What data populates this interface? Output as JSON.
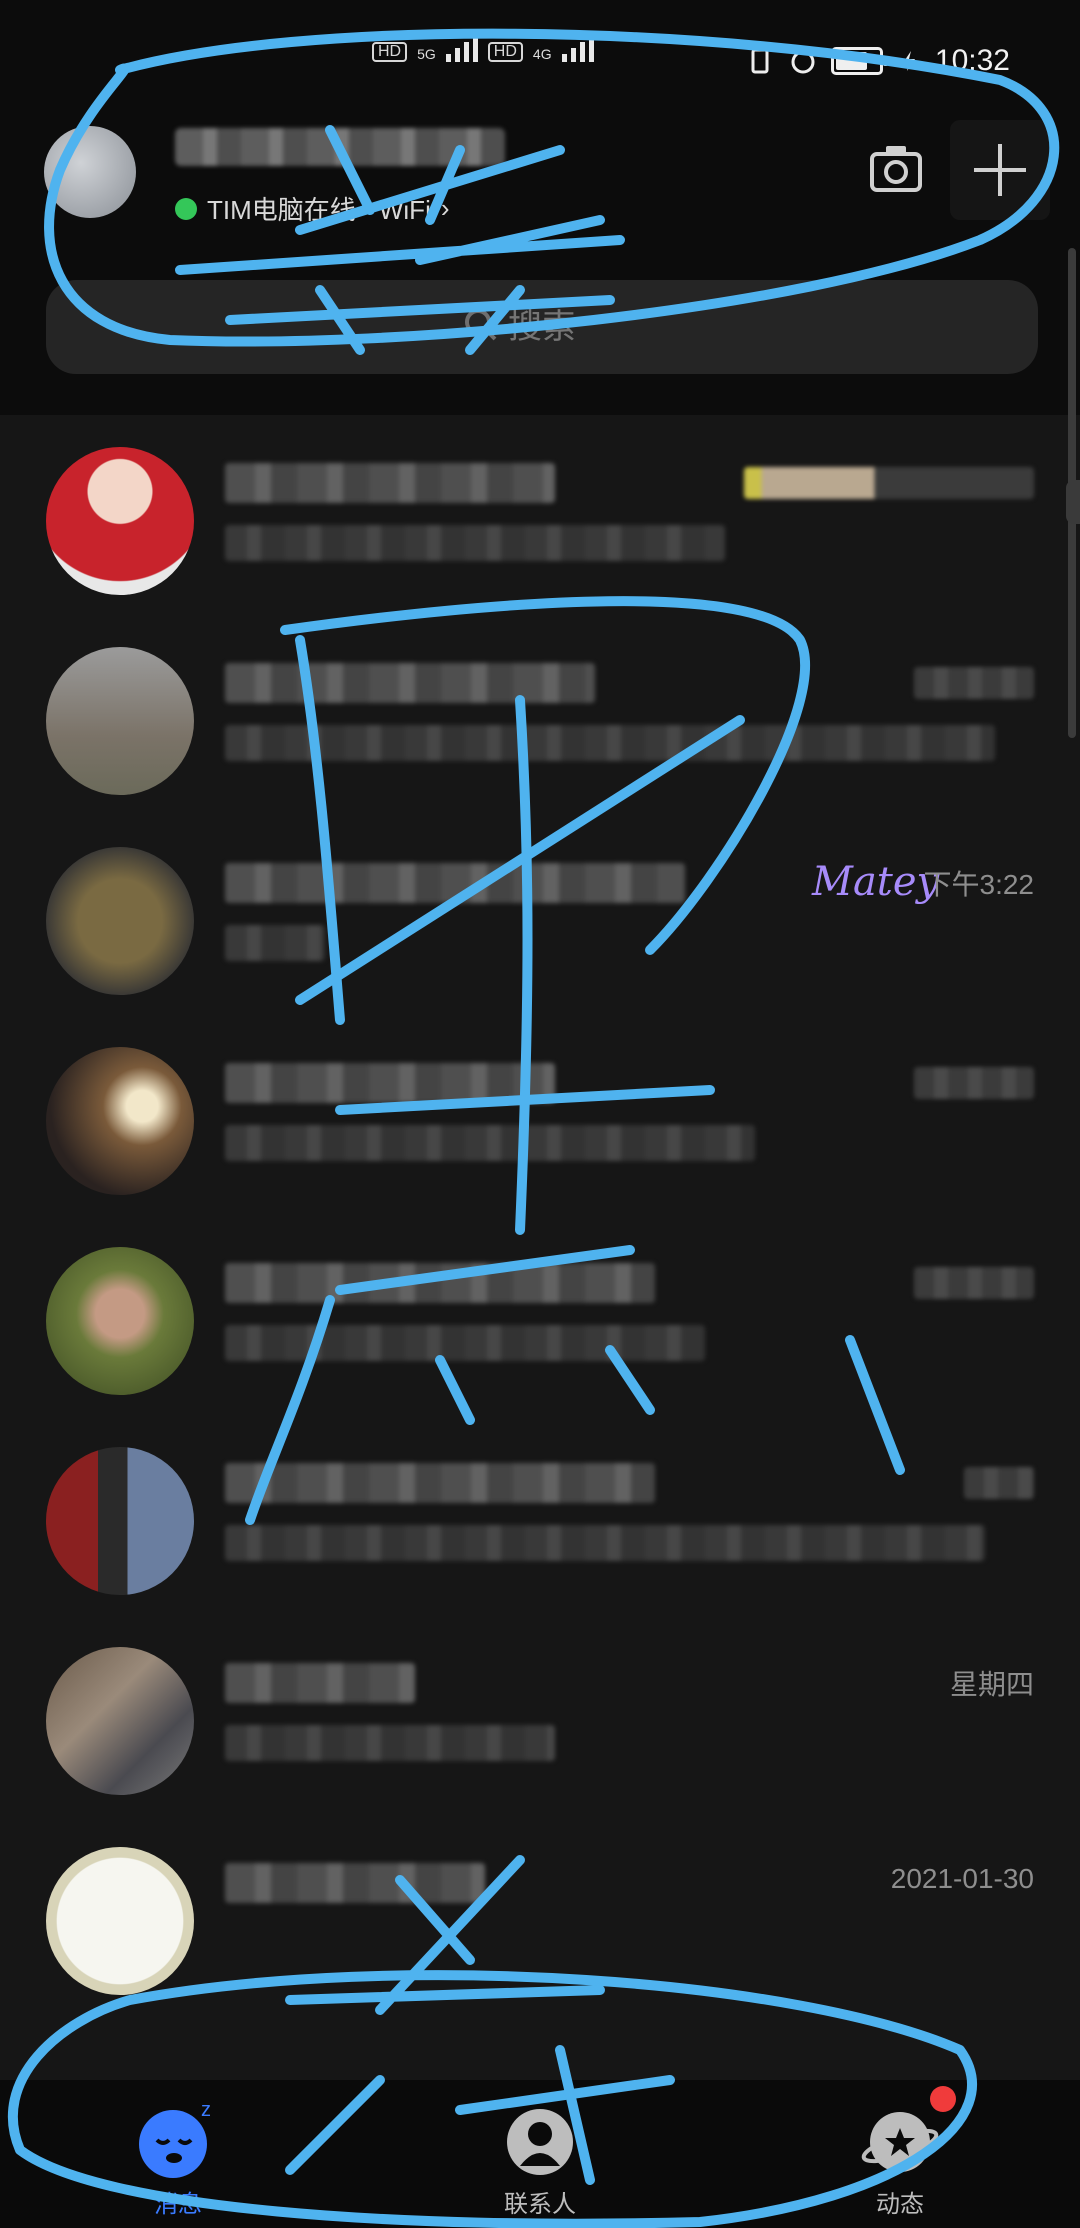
{
  "status_bar": {
    "hd1": "HD",
    "network_5g": "5G",
    "hd2": "HD",
    "network_4g": "4G",
    "time": "10:32"
  },
  "header": {
    "online_status": "TIM电脑在线 - WiFi",
    "chevron": "›",
    "camera_icon": "camera-icon",
    "add_icon": "plus-icon"
  },
  "search": {
    "placeholder": "搜索"
  },
  "chats": [
    {
      "time": ""
    },
    {
      "time": ""
    },
    {
      "time": "下午3:22",
      "decoration": "Matey"
    },
    {
      "time": ""
    },
    {
      "time": ""
    },
    {
      "time": ""
    },
    {
      "time": "星期四"
    },
    {
      "time": "2021-01-30"
    }
  ],
  "tabs": [
    {
      "label": "消息",
      "icon": "sleeping-face-icon",
      "active": true
    },
    {
      "label": "联系人",
      "icon": "person-icon",
      "active": false
    },
    {
      "label": "动态",
      "icon": "star-planet-icon",
      "active": false
    }
  ],
  "colors": {
    "background": "#161616",
    "accent": "#3a7bff",
    "scribble": "#4fb3ef",
    "online": "#34c759",
    "badge": "#f03b3b"
  }
}
